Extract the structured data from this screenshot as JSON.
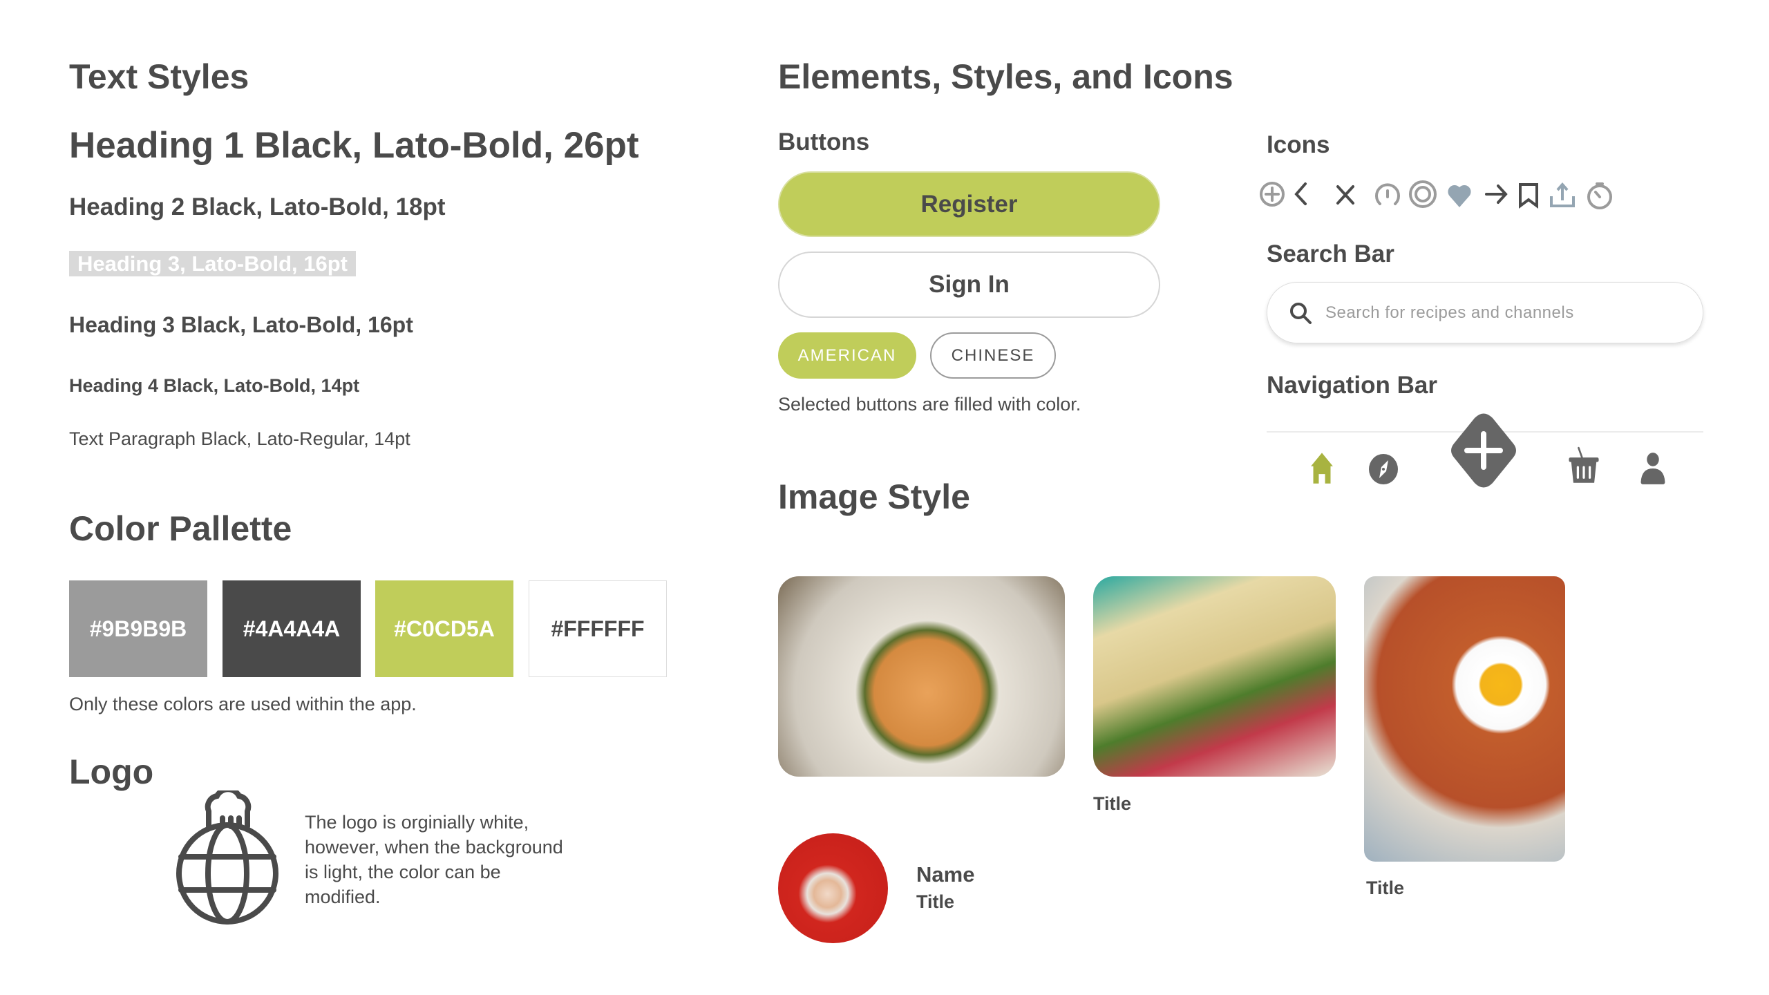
{
  "text_styles": {
    "title": "Text Styles",
    "h1": "Heading 1 Black, Lato-Bold, 26pt",
    "h2": "Heading 2 Black, Lato-Bold, 18pt",
    "h3_white": "Heading 3, Lato-Bold, 16pt",
    "h3": "Heading 3 Black, Lato-Bold, 16pt",
    "h4": "Heading 4 Black, Lato-Bold, 14pt",
    "paragraph": "Text Paragraph Black, Lato-Regular, 14pt"
  },
  "palette": {
    "title": "Color Pallette",
    "swatches": [
      {
        "label": "#9B9B9B",
        "color": "#9B9B9B"
      },
      {
        "label": "#4A4A4A",
        "color": "#4A4A4A"
      },
      {
        "label": "#C0CD5A",
        "color": "#C0CD5A"
      },
      {
        "label": "#FFFFFF",
        "color": "#FFFFFF"
      }
    ],
    "note": "Only these colors are used within the app."
  },
  "logo": {
    "title": "Logo",
    "icon": "chef-hat-globe-icon",
    "description": "The logo is orginially white, however, when the background is light, the color can be modified."
  },
  "elements": {
    "title": "Elements, Styles, and Icons"
  },
  "buttons": {
    "title": "Buttons",
    "register": "Register",
    "sign_in": "Sign In",
    "chips": [
      {
        "label": "AMERICAN",
        "selected": true
      },
      {
        "label": "CHINESE",
        "selected": false
      }
    ],
    "note": "Selected buttons are filled with color."
  },
  "icons": {
    "title": "Icons",
    "items": [
      "plus-circle-icon",
      "chevron-left-icon",
      "close-icon",
      "gauge-icon",
      "target-icon",
      "heart-icon",
      "arrow-right-icon",
      "bookmark-icon",
      "share-icon",
      "timer-icon"
    ]
  },
  "search": {
    "title": "Search Bar",
    "placeholder": "Search for recipes and channels"
  },
  "navbar": {
    "title": "Navigation Bar",
    "items": [
      "home-icon",
      "compass-icon",
      "add-icon",
      "basket-icon",
      "profile-icon"
    ],
    "active": "home-icon"
  },
  "image_style": {
    "title": "Image Style",
    "cards": [
      {
        "title": ""
      },
      {
        "title": "Title"
      },
      {
        "title": "Title"
      }
    ],
    "profile": {
      "name": "Name",
      "title": "Title"
    }
  },
  "colors": {
    "accent": "#C0CD5A",
    "dark": "#4A4A4A",
    "gray": "#9B9B9B",
    "icon_blue": "#94A5B2"
  }
}
